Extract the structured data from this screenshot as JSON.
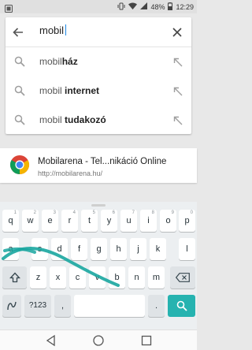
{
  "status_bar": {
    "battery": "48%",
    "time": "12:29"
  },
  "search": {
    "query": "mobil"
  },
  "suggestions": [
    {
      "prefix": "mobil",
      "suffix": "ház"
    },
    {
      "prefix": "mobil ",
      "suffix": "internet"
    },
    {
      "prefix": "mobil ",
      "suffix": "tudakozó"
    }
  ],
  "result": {
    "title": "Mobilarena - Tel...nikáció Online",
    "url": "http://mobilarena.hu/"
  },
  "keyboard": {
    "row1": [
      {
        "label": "q",
        "hint": "1"
      },
      {
        "label": "w",
        "hint": "2"
      },
      {
        "label": "e",
        "hint": "3"
      },
      {
        "label": "r",
        "hint": "4"
      },
      {
        "label": "t",
        "hint": "5"
      },
      {
        "label": "y",
        "hint": "6"
      },
      {
        "label": "u",
        "hint": "7"
      },
      {
        "label": "i",
        "hint": "8"
      },
      {
        "label": "o",
        "hint": "9"
      },
      {
        "label": "p",
        "hint": "0"
      }
    ],
    "row2": [
      "a",
      "s",
      "d",
      "f",
      "g",
      "h",
      "j",
      "k",
      "l"
    ],
    "row3": [
      "z",
      "x",
      "c",
      "v",
      "b",
      "n",
      "m"
    ],
    "symbols_label": "?123",
    "comma": ",",
    "period": ".",
    "accent_color": "#26b3b0",
    "swipe_trail_color": "#1aa6a0"
  }
}
